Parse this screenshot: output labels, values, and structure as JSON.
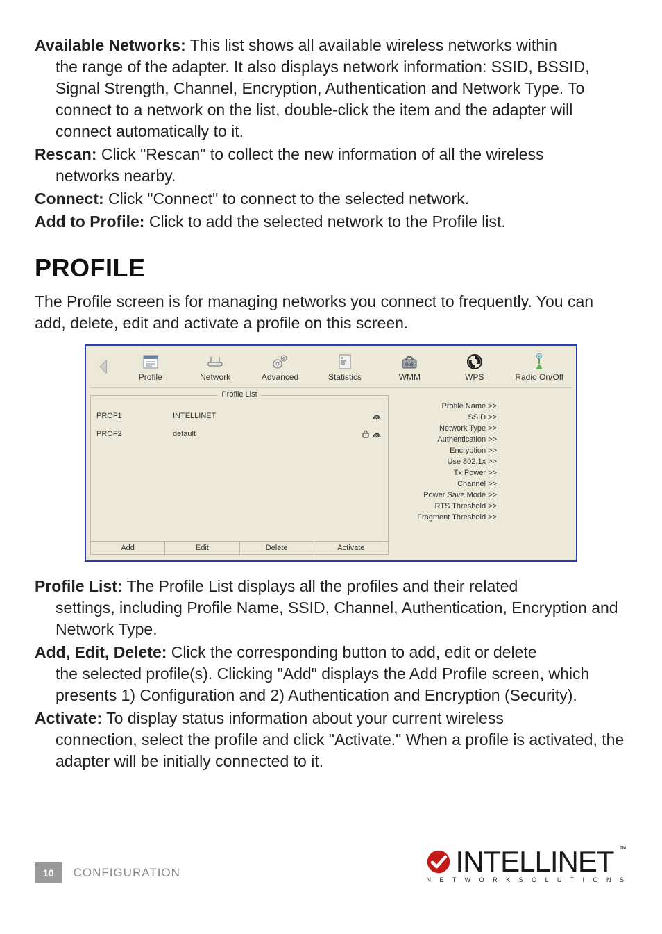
{
  "definitions_top": [
    {
      "term": "Available Networks:",
      "body_first": " This list shows all available wireless networks within",
      "body_rest": "the range of the adapter. It also displays network information: SSID, BSSID, Signal Strength, Channel, Encryption, Authentication and Network Type. To connect to a network on the list, double-click the item and the adapter will connect automatically to it."
    },
    {
      "term": "Rescan:",
      "body_first": " Click \"Rescan\" to collect the new information of all the wireless",
      "body_rest": "networks nearby."
    },
    {
      "term": "Connect:",
      "body_first": " Click \"Connect\" to connect to the selected network.",
      "body_rest": ""
    },
    {
      "term": "Add to Profile:",
      "body_first": " Click to add the selected network to the Profile list.",
      "body_rest": ""
    }
  ],
  "section_heading": "profile",
  "intro_paragraph": "The Profile screen is for managing networks you connect to frequently. You can add, delete, edit and activate a profile on this screen.",
  "ui": {
    "tabs": [
      {
        "label": "Profile",
        "icon": "profile"
      },
      {
        "label": "Network",
        "icon": "network"
      },
      {
        "label": "Advanced",
        "icon": "advanced"
      },
      {
        "label": "Statistics",
        "icon": "statistics"
      },
      {
        "label": "WMM",
        "icon": "wmm"
      },
      {
        "label": "WPS",
        "icon": "wps"
      },
      {
        "label": "Radio On/Off",
        "icon": "radio"
      }
    ],
    "profile_list_label": "Profile List",
    "profiles": [
      {
        "name": "PROF1",
        "ssid": "INTELLINET",
        "lock": false,
        "signal": true
      },
      {
        "name": "PROF2",
        "ssid": "default",
        "lock": true,
        "signal": true
      }
    ],
    "buttons": {
      "add": "Add",
      "edit": "Edit",
      "del": "Delete",
      "activate": "Activate"
    },
    "details": [
      "Profile Name >>",
      "SSID >>",
      "Network Type >>",
      "Authentication >>",
      "Encryption >>",
      "Use 802.1x >>",
      "Tx Power >>",
      "Channel >>",
      "Power Save Mode >>",
      "RTS Threshold >>",
      "Fragment Threshold >>"
    ]
  },
  "definitions_bottom": [
    {
      "term": "Profile List:",
      "body_first": " The Profile List displays all the profiles and their related",
      "body_rest": "settings, including Profile Name, SSID, Channel, Authentication, Encryption and Network Type."
    },
    {
      "term": "Add, Edit, Delete:",
      "body_first": " Click the corresponding button to add, edit or delete",
      "body_rest": "the selected profile(s). Clicking \"Add\" displays the Add Profile screen, which presents 1) Configuration and 2) Authentication and Encryption (Security)."
    },
    {
      "term": "Activate:",
      "body_first": " To display status information about your current wireless",
      "body_rest": "connection, select the profile and click \"Activate.\" When a profile is activated, the adapter will be initially connected to it."
    }
  ],
  "footer": {
    "page": "10",
    "label": "CONFIGURATION",
    "brand": "INTELLINET",
    "brand_sub": "N E T W O R K   S O L U T I O N S"
  }
}
